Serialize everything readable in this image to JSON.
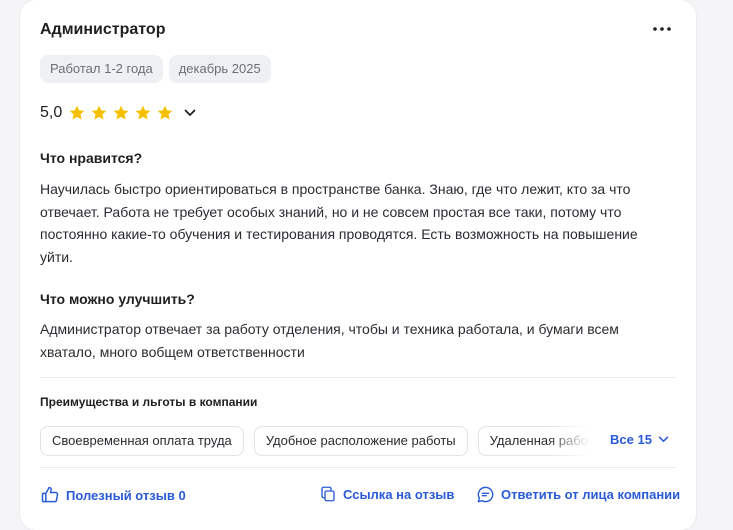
{
  "review": {
    "position": "Администратор",
    "tags": [
      "Работал 1-2 года",
      "декабрь 2025"
    ],
    "rating": "5,0",
    "stars_filled": 5,
    "stars_total": 5,
    "pros_title": "Что нравится?",
    "pros_text": "Научилась быстро ориентироваться в пространстве банка. Знаю, где что лежит, кто за что отвечает. Работа не требует особых знаний, но и не совсем простая все таки, потому что постоянно какие-то обучения и тестирования проводятся. Есть возможность на повышение уйти.",
    "cons_title": "Что можно улучшить?",
    "cons_text": "Администратор отвечает за работу отделения, чтобы и техника работала, и бумаги всем хватало, много вобщем ответственности"
  },
  "benefits": {
    "title": "Преимущества и льготы в компании",
    "chips": [
      "Своевременная оплата труда",
      "Удобное расположение работы",
      "Удаленная работа"
    ],
    "more_label": "Все 15"
  },
  "actions": {
    "helpful_label": "Полезный отзыв 0",
    "link_label": "Ссылка на отзыв",
    "reply_label": "Ответить от лица компании"
  },
  "icons": {
    "menu": "more-horizontal-icon",
    "star": "star-icon",
    "chevron": "chevron-down-icon",
    "like": "thumbs-up-icon",
    "copy": "copy-link-icon",
    "reply": "chat-bubble-icon"
  },
  "colors": {
    "accent": "#2a5bd7",
    "star": "#f5c000",
    "tag_bg": "#eef0f4"
  }
}
